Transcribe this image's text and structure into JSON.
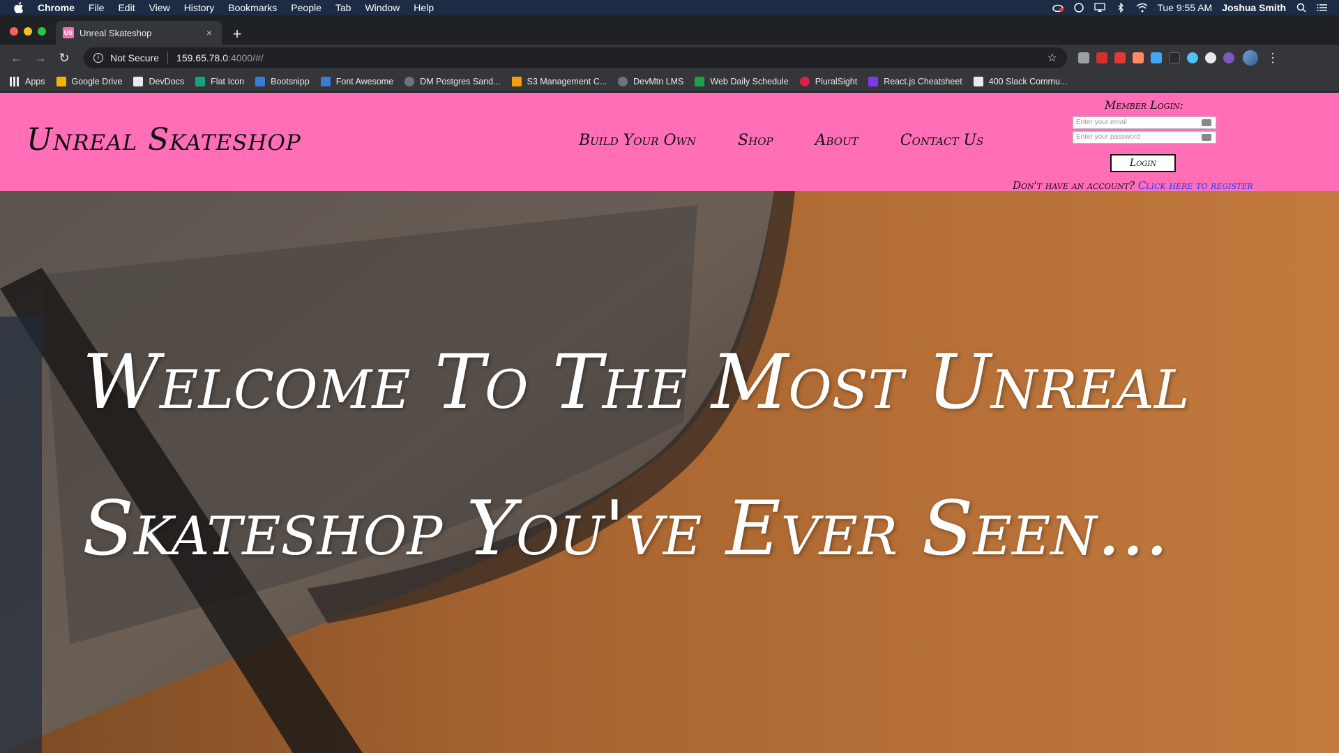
{
  "menubar": {
    "app": "Chrome",
    "items": [
      "File",
      "Edit",
      "View",
      "History",
      "Bookmarks",
      "People",
      "Tab",
      "Window",
      "Help"
    ],
    "clock": "Tue 9:55 AM",
    "user": "Joshua Smith"
  },
  "browser": {
    "tab_title": "Unreal Skateshop",
    "tab_favicon": "US",
    "new_tab": "+",
    "close_tab": "×",
    "security": "Not Secure",
    "url_host": "159.65.78.0",
    "url_path": ":4000/#/",
    "bookmarks": [
      {
        "label": "Apps",
        "color": "#e8eaed"
      },
      {
        "label": "Google Drive",
        "color": "#f4b400"
      },
      {
        "label": "DevDocs",
        "color": "#e8eaed"
      },
      {
        "label": "Flat Icon",
        "color": "#16a085"
      },
      {
        "label": "Bootsnipp",
        "color": "#3a7bd5"
      },
      {
        "label": "Font Awesome",
        "color": "#3a7bd5"
      },
      {
        "label": "DM Postgres Sand...",
        "color": "#6b7280"
      },
      {
        "label": "S3 Management C...",
        "color": "#f59e0b"
      },
      {
        "label": "DevMtn LMS",
        "color": "#6b7280"
      },
      {
        "label": "Web Daily Schedule",
        "color": "#16a34a"
      },
      {
        "label": "PluralSight",
        "color": "#e11d48"
      },
      {
        "label": "React.js Cheatsheet",
        "color": "#7c3aed"
      },
      {
        "label": "400 Slack Commu...",
        "color": "#e8eaed"
      }
    ]
  },
  "site": {
    "logo": "Unreal Skateshop",
    "nav": [
      "Build Your Own",
      "Shop",
      "About",
      "Contact Us"
    ],
    "login": {
      "title": "Member Login:",
      "email_placeholder": "Enter your email",
      "password_placeholder": "Enter your password",
      "button": "Login",
      "register_prompt": "Don't have an account?",
      "register_link": "Click here to register"
    },
    "hero_line1": "Welcome To The Most Unreal",
    "hero_line2": "Skateshop You've Ever Seen...",
    "colors": {
      "header_bg": "#ff6eb7",
      "link": "#1a3bff"
    }
  }
}
